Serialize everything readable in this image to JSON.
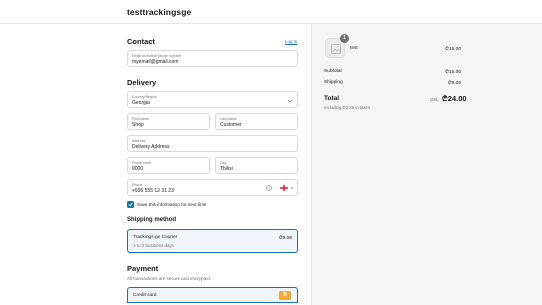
{
  "header": {
    "shop_name": "testtrackingsge"
  },
  "contact": {
    "title": "Contact",
    "login_label": "Log in",
    "email": {
      "label": "Email or mobile phone number",
      "value": "myemail@gmail.com"
    }
  },
  "delivery": {
    "title": "Delivery",
    "country": {
      "label": "Country/Region",
      "value": "Georgia"
    },
    "first_name": {
      "label": "First name",
      "value": "Shop"
    },
    "last_name": {
      "label": "Last name",
      "value": "Customer"
    },
    "address": {
      "label": "Address",
      "value": "Delivery Address"
    },
    "postal_code": {
      "label": "Postal code",
      "value": "0000"
    },
    "city": {
      "label": "City",
      "value": "Tbilisi"
    },
    "phone": {
      "label": "Phone",
      "value": "+995 555 12 31 23"
    },
    "save_info": {
      "label": "Save this information for next time",
      "checked": true
    }
  },
  "shipping_method": {
    "title": "Shipping method",
    "option": {
      "name": "Trackings.ge Courier",
      "days": "1 to 2 business days",
      "price": "₾9.00"
    }
  },
  "payment": {
    "title": "Payment",
    "subtitle": "All transactions are secure and encrypted.",
    "method": {
      "label": "Credit card",
      "badge": "B"
    }
  },
  "summary": {
    "item": {
      "name": "test",
      "price": "₾15.00",
      "quantity": "1"
    },
    "subtotal": {
      "label": "Subtotal",
      "value": "₾15.00"
    },
    "shipping": {
      "label": "Shipping",
      "value": "₾9.00"
    },
    "total": {
      "label": "Total",
      "currency": "GEL",
      "value": "₾24.00"
    },
    "tax_note": "Including ₾2.29 in taxes"
  },
  "colors": {
    "accent": "#1773b0",
    "panel": "#f5f5f5",
    "badge": "#f4a83a"
  }
}
